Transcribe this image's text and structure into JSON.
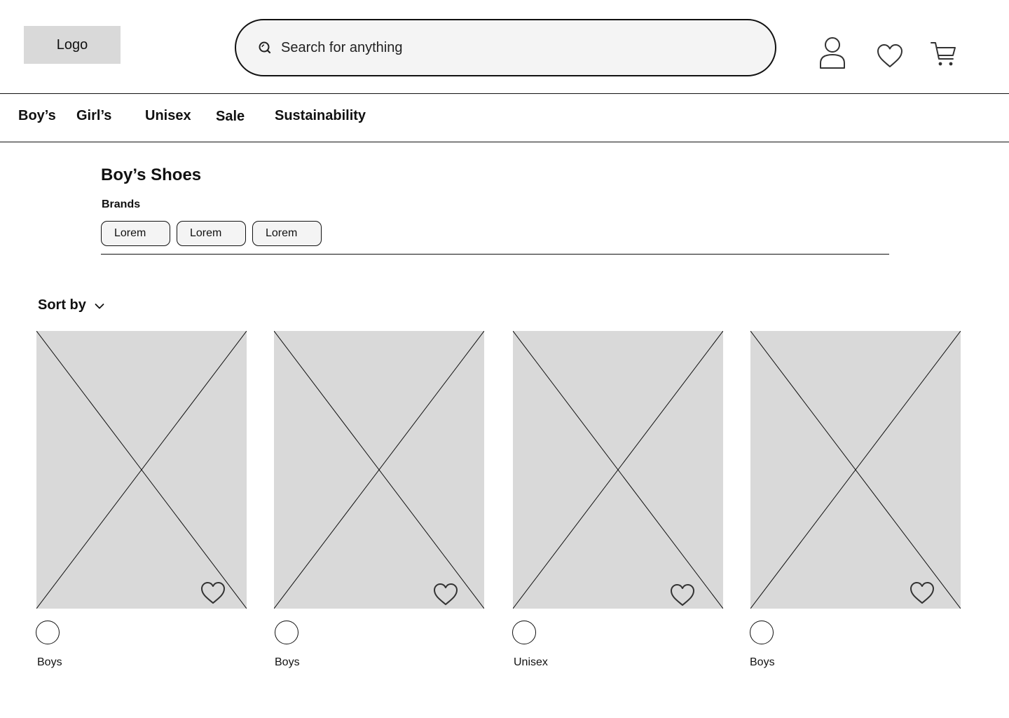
{
  "header": {
    "logo_label": "Logo",
    "search": {
      "placeholder": "Search for anything",
      "value": ""
    },
    "icons": [
      "user-icon",
      "heart-icon",
      "cart-icon"
    ]
  },
  "nav": {
    "items": [
      {
        "label": "Boy’s"
      },
      {
        "label": "Girl’s"
      },
      {
        "label": "Unisex"
      },
      {
        "label": "Sale"
      },
      {
        "label": "Sustainability"
      }
    ]
  },
  "main": {
    "title": "Boy’s Shoes",
    "brands_label": "Brands",
    "brand_chips": [
      "Lorem",
      "Lorem",
      "Lorem"
    ],
    "sort_label": "Sort by"
  },
  "products": [
    {
      "category": "Boys"
    },
    {
      "category": "Boys"
    },
    {
      "category": "Unisex"
    },
    {
      "category": "Boys"
    }
  ],
  "colors": {
    "placeholder_gray": "#d9d9d9",
    "input_bg": "#f4f4f4",
    "ink": "#111111"
  }
}
